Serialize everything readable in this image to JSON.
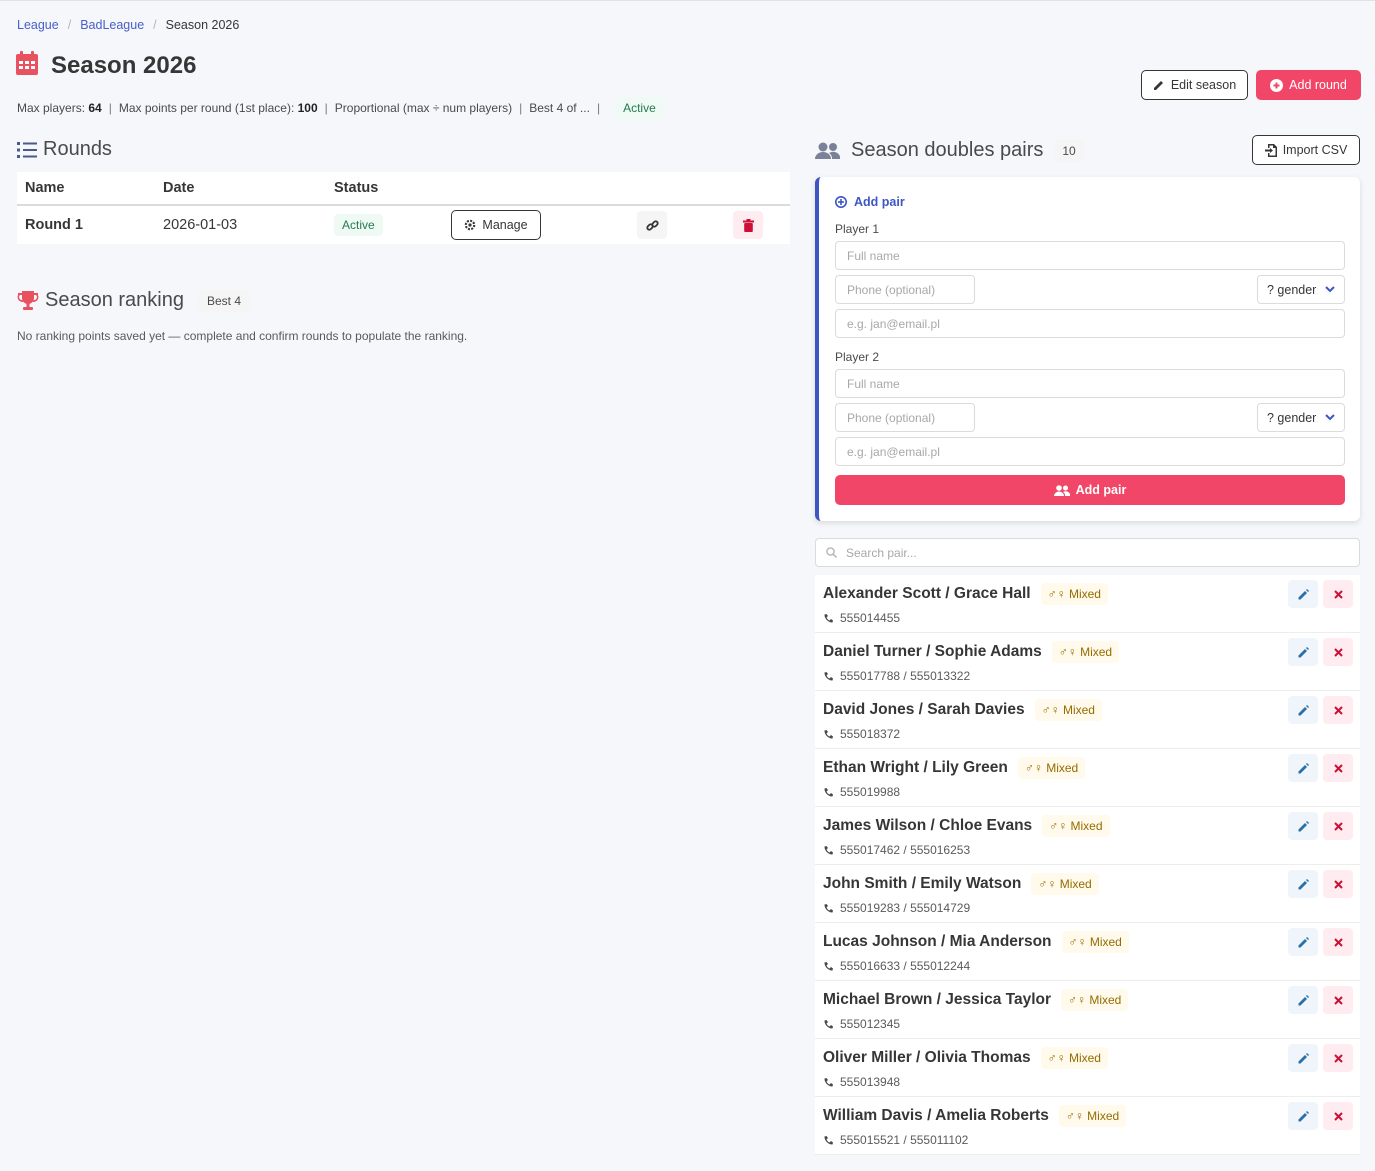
{
  "breadcrumb": [
    "League",
    "BadLeague",
    "Season 2026"
  ],
  "page": {
    "title": "Season 2026",
    "meta": {
      "max_players_label": "Max players:",
      "max_players": "64",
      "max_points_label": "Max points per round (1st place):",
      "max_points": "100",
      "scoring": "Proportional (max ÷ num players)",
      "best": "Best 4 of ...",
      "status": "Active"
    },
    "buttons": {
      "edit_season": "Edit season",
      "add_round": "Add round"
    }
  },
  "rounds": {
    "title": "Rounds",
    "columns": [
      "Name",
      "Date",
      "Status"
    ],
    "rows": [
      {
        "name": "Round 1",
        "date": "2026-01-03",
        "status": "Active",
        "manage": "Manage"
      }
    ]
  },
  "ranking": {
    "title": "Season ranking",
    "badge": "Best 4",
    "empty": "No ranking points saved yet — complete and confirm rounds to populate the ranking."
  },
  "pairs": {
    "title": "Season doubles pairs",
    "count": "10",
    "import_button": "Import CSV",
    "form": {
      "heading": "Add pair",
      "player1_label": "Player 1",
      "player2_label": "Player 2",
      "name_placeholder": "Full name",
      "phone_placeholder": "Phone (optional)",
      "email_placeholder": "e.g. jan@email.pl",
      "gender_value": "? gender",
      "submit": "Add pair"
    },
    "search_placeholder": "Search pair...",
    "list": [
      {
        "name": "Alexander Scott / Grace Hall",
        "tag": "♂♀ Mixed",
        "phones": "555014455"
      },
      {
        "name": "Daniel Turner / Sophie Adams",
        "tag": "♂♀ Mixed",
        "phones": "555017788 / 555013322"
      },
      {
        "name": "David Jones / Sarah Davies",
        "tag": "♂♀ Mixed",
        "phones": "555018372"
      },
      {
        "name": "Ethan Wright / Lily Green",
        "tag": "♂♀ Mixed",
        "phones": "555019988"
      },
      {
        "name": "James Wilson / Chloe Evans",
        "tag": "♂♀ Mixed",
        "phones": "555017462 / 555016253"
      },
      {
        "name": "John Smith / Emily Watson",
        "tag": "♂♀ Mixed",
        "phones": "555019283 / 555014729"
      },
      {
        "name": "Lucas Johnson / Mia Anderson",
        "tag": "♂♀ Mixed",
        "phones": "555016633 / 555012244"
      },
      {
        "name": "Michael Brown / Jessica Taylor",
        "tag": "♂♀ Mixed",
        "phones": "555012345"
      },
      {
        "name": "Oliver Miller / Olivia Thomas",
        "tag": "♂♀ Mixed",
        "phones": "555013948"
      },
      {
        "name": "William Davis / Amelia Roberts",
        "tag": "♂♀ Mixed",
        "phones": "555015521 / 555011102"
      }
    ]
  },
  "colors": {
    "accent": "#f14668",
    "link": "#485fc7",
    "card_border": "#3e56c4",
    "success_bg": "#effaf5",
    "success_text": "#257953"
  }
}
